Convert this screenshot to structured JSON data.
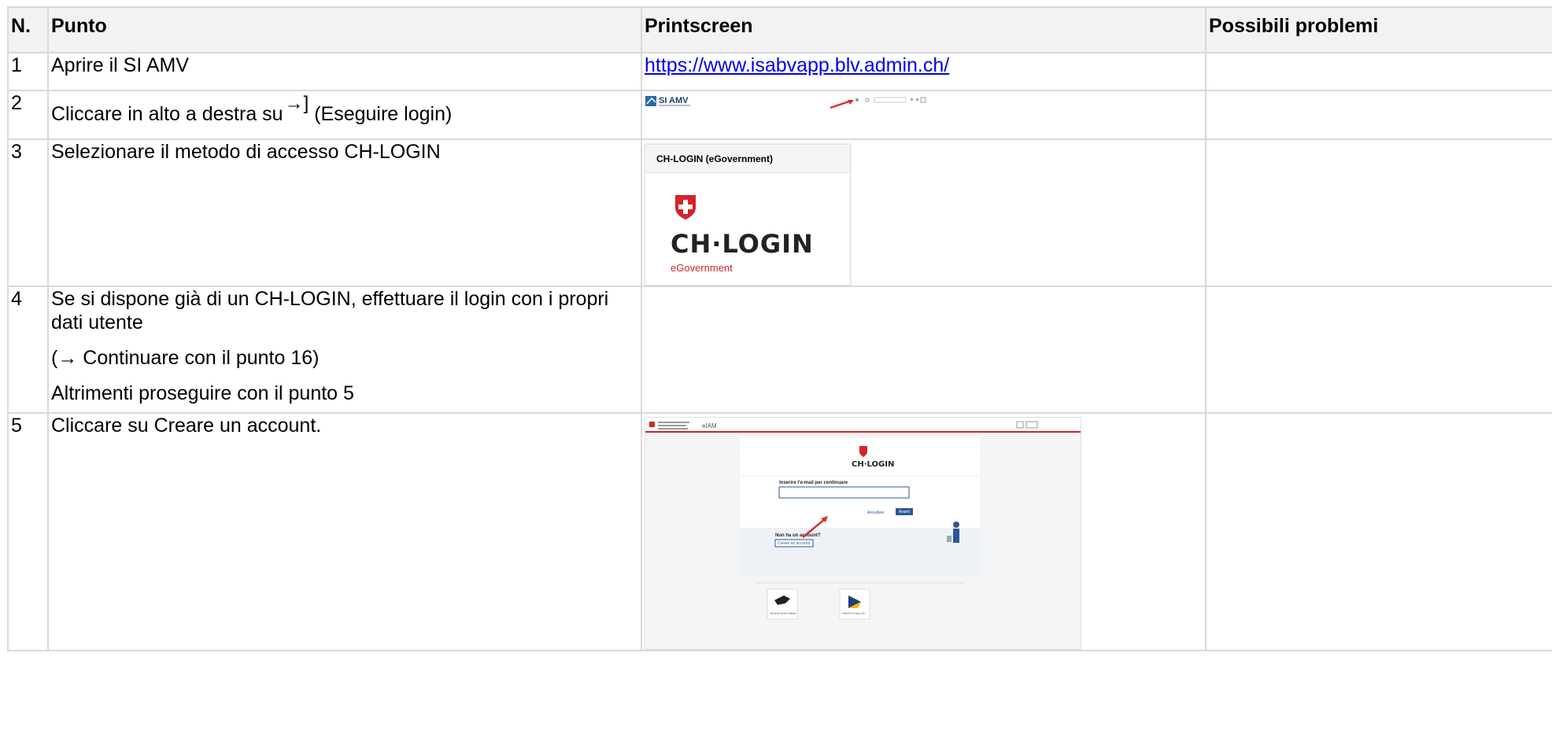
{
  "headers": [
    "N.",
    "Punto",
    "Printscreen",
    "Possibili problemi"
  ],
  "rows": [
    {
      "n": "1",
      "punto": "Aprire il SI AMV",
      "link": "https://www.isabvapp.blv.admin.ch/"
    },
    {
      "n": "2",
      "punto_before": "Cliccare in alto a destra su",
      "punto_icon": "→]",
      "punto_after": " (Eseguire login)",
      "shot_app": "SI AMV"
    },
    {
      "n": "3",
      "punto": "Selezionare il metodo di accesso CH-LOGIN",
      "shot_title": "CH-LOGIN (eGovernment)",
      "shot_logo": "CH·LOGIN",
      "shot_sub": "eGovernment"
    },
    {
      "n": "4",
      "lines": [
        "Se si dispone già di un CH-LOGIN, effettuare il login con i propri dati utente",
        "(→ Continuare con il punto 16)",
        "Altrimenti proseguire con il punto 5"
      ]
    },
    {
      "n": "5",
      "punto": "Cliccare su Creare un account.",
      "shot": {
        "header": "eIAM",
        "logo": "CH·LOGIN",
        "email_prompt": "Inserire l'e-mail per continuare",
        "cancel": "Annullare",
        "next": "Avanti",
        "no_account": "Non ha un account?",
        "create": "Creare un account",
        "alt1": "Gli enti UHH effect",
        "alt2": "SWITCH edu-ID"
      }
    }
  ]
}
